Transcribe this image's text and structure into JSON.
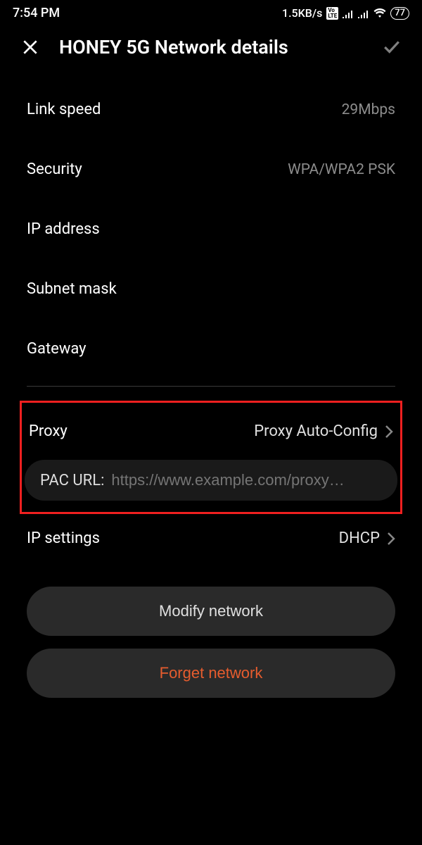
{
  "status": {
    "time": "7:54 PM",
    "speed": "1.5KB/s",
    "battery": "77"
  },
  "header": {
    "title": "HONEY 5G Network details"
  },
  "details": {
    "link_speed": {
      "label": "Link speed",
      "value": "29Mbps"
    },
    "security": {
      "label": "Security",
      "value": "WPA/WPA2 PSK"
    },
    "ip_address": {
      "label": "IP address",
      "value": ""
    },
    "subnet_mask": {
      "label": "Subnet mask",
      "value": ""
    },
    "gateway": {
      "label": "Gateway",
      "value": ""
    }
  },
  "proxy": {
    "label": "Proxy",
    "value": "Proxy Auto-Config",
    "pac_label": "PAC URL:",
    "pac_placeholder": "https://www.example.com/proxy…"
  },
  "ip_settings": {
    "label": "IP settings",
    "value": "DHCP"
  },
  "buttons": {
    "modify": "Modify network",
    "forget": "Forget network"
  }
}
